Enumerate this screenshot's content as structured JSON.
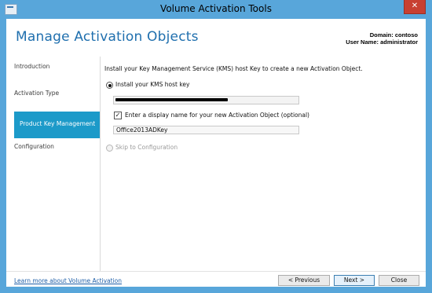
{
  "window": {
    "title": "Volume Activation Tools",
    "close_glyph": "✕"
  },
  "header": {
    "title": "Manage Activation Objects",
    "domain_line": "Domain: contoso",
    "user_line": "User Name: administrator"
  },
  "nav": {
    "items": [
      {
        "label": "Introduction",
        "active": false
      },
      {
        "label": "Activation Type",
        "active": false
      },
      {
        "label": "Product Key Management",
        "active": true
      },
      {
        "label": "Configuration",
        "active": false
      }
    ]
  },
  "content": {
    "intro": "Install your Key Management Service (KMS) host Key to create a new Activation Object.",
    "install_option": {
      "label": "Install your KMS host key",
      "selected": true
    },
    "kms_key_field": {
      "value": "",
      "redacted": true
    },
    "display_name_checkbox": {
      "label": "Enter a display name for your new Activation Object (optional)",
      "checked": true,
      "check_glyph": "✓"
    },
    "display_name_field": {
      "value": "Office2013ADKey"
    },
    "skip_option": {
      "label": "Skip to Configuration",
      "selected": false,
      "enabled": false
    }
  },
  "footer": {
    "learn_more": "Learn more about Volume Activation",
    "previous_label": "< Previous",
    "next_label": "Next >",
    "close_label": "Close"
  },
  "colors": {
    "window_frame": "#58a6da",
    "heading": "#1f6fae",
    "nav_active": "#1c9ac9",
    "close_button": "#c84031",
    "link": "#1f5fa8"
  }
}
